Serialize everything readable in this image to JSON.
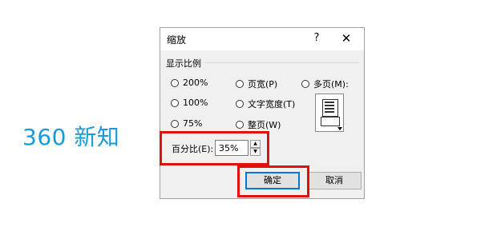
{
  "watermark": "360 新知",
  "dialog": {
    "title": "缩放",
    "help": "?",
    "close": "✕",
    "group_label": "显示比例",
    "radios": {
      "r200": "200%",
      "r100": "100%",
      "r75": "75%",
      "page_width": "页宽(P)",
      "text_width": "文字宽度(T)",
      "whole_page": "整页(W)",
      "many_pages": "多页(M):"
    },
    "percent_label": "百分比(E):",
    "percent_value": "35%",
    "ok": "确定",
    "cancel": "取消"
  },
  "colors": {
    "accent": "#0078d7",
    "highlight": "#e01010",
    "watermark": "#1a9ad6"
  }
}
